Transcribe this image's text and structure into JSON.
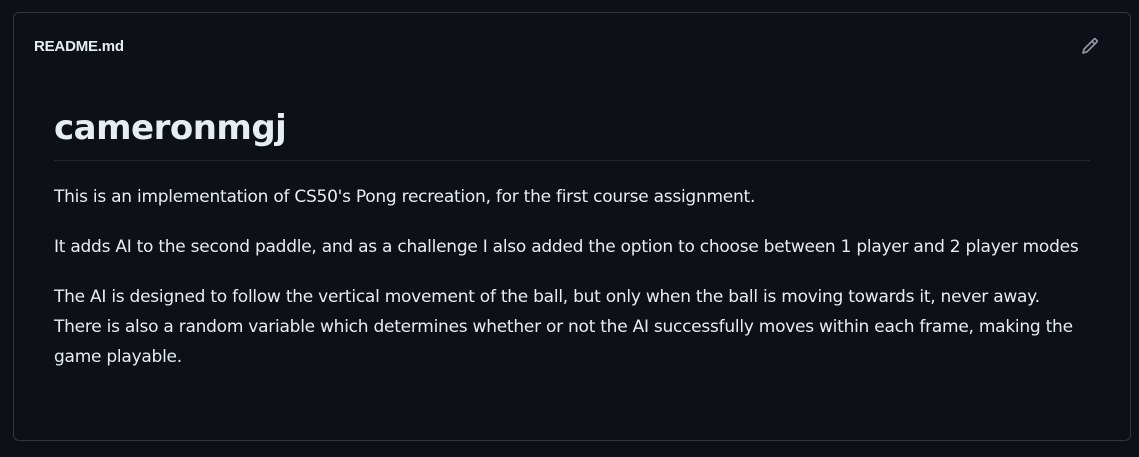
{
  "readme": {
    "filename": "README.md",
    "edit_icon": "pencil-icon",
    "title": "cameronmgj",
    "paragraphs": [
      "This is an implementation of CS50's Pong recreation, for the first course assignment.",
      "It adds AI to the second paddle, and as a challenge I also added the option to choose between 1 player and 2 player modes",
      "The AI is designed to follow the vertical movement of the ball, but only when the ball is moving towards it, never away. There is also a random variable which determines whether or not the AI successfully moves within each frame, making the game playable."
    ]
  },
  "colors": {
    "background": "#0d1117",
    "border": "#30363d",
    "text": "#e6edf3",
    "icon": "#9198a1"
  }
}
